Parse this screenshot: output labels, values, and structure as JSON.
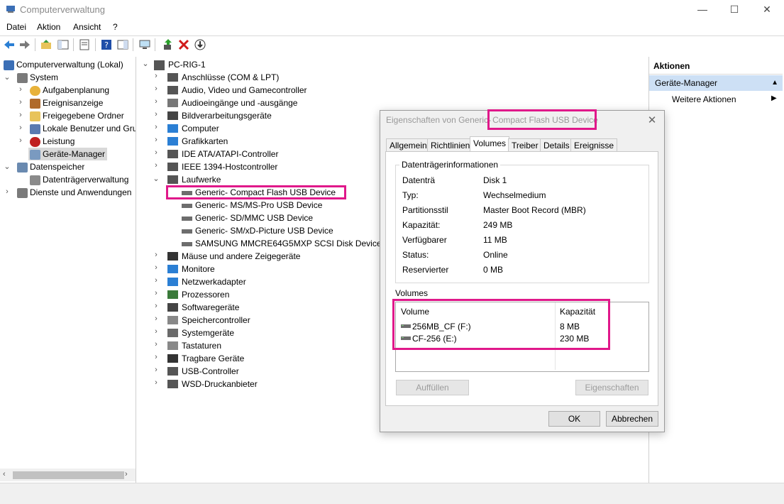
{
  "window": {
    "title": "Computerverwaltung",
    "minimize": "—",
    "maximize": "☐",
    "close": "✕"
  },
  "menu": [
    "Datei",
    "Aktion",
    "Ansicht",
    "?"
  ],
  "left_tree": [
    {
      "label": "Computerverwaltung (Lokal)",
      "icon": "computer-management-icon"
    },
    {
      "label": "System",
      "icon": "system-tools-icon"
    },
    {
      "label": "Aufgabenplanung",
      "icon": "clock-icon"
    },
    {
      "label": "Ereignisanzeige",
      "icon": "event-viewer-icon"
    },
    {
      "label": "Freigegebene Ordner",
      "icon": "shared-folder-icon"
    },
    {
      "label": "Lokale Benutzer und Gru",
      "icon": "users-icon"
    },
    {
      "label": "Leistung",
      "icon": "performance-icon"
    },
    {
      "label": "Geräte-Manager",
      "icon": "device-manager-icon"
    },
    {
      "label": "Datenspeicher",
      "icon": "storage-icon"
    },
    {
      "label": "Datenträgerverwaltung",
      "icon": "disk-management-icon"
    },
    {
      "label": "Dienste und Anwendungen",
      "icon": "services-icon"
    }
  ],
  "device_tree": {
    "root": "PC-RIG-1",
    "categories": [
      "Anschlüsse (COM & LPT)",
      "Audio, Video und Gamecontroller",
      "Audioeingänge und -ausgänge",
      "Bildverarbeitungsgeräte",
      "Computer",
      "Grafikkarten",
      "IDE ATA/ATAPI-Controller",
      "IEEE 1394-Hostcontroller",
      "Laufwerke"
    ],
    "drives": [
      "Generic- Compact Flash USB Device",
      "Generic- MS/MS-Pro USB Device",
      "Generic- SD/MMC USB Device",
      "Generic- SM/xD-Picture USB Device",
      "SAMSUNG MMCRE64G5MXP SCSI Disk Device"
    ],
    "categories_after": [
      "Mäuse und andere Zeigegeräte",
      "Monitore",
      "Netzwerkadapter",
      "Prozessoren",
      "Softwaregeräte",
      "Speichercontroller",
      "Systemgeräte",
      "Tastaturen",
      "Tragbare Geräte",
      "USB-Controller",
      "WSD-Druckanbieter"
    ]
  },
  "actions": {
    "header": "Aktionen",
    "section": "Geräte-Manager",
    "more": "Weitere Aktionen"
  },
  "dialog": {
    "title_prefix": "Eigenschaften von Generic-",
    "title_highlight": "Compact Flash USB Device",
    "tabs": [
      "Allgemein",
      "Richtlinien",
      "Volumes",
      "Treiber",
      "Details",
      "Ereignisse"
    ],
    "group_title": "Datenträgerinformationen",
    "info": [
      {
        "k": "Datenträ",
        "v": "Disk 1"
      },
      {
        "k": "Typ:",
        "v": "Wechselmedium"
      },
      {
        "k": "Partitionsstil",
        "v": "Master Boot Record (MBR)"
      },
      {
        "k": "Kapazität:",
        "v": "249 MB"
      },
      {
        "k": "Verfügbarer",
        "v": "11 MB"
      },
      {
        "k": "Status:",
        "v": "Online"
      },
      {
        "k": "Reservierter",
        "v": "0 MB"
      }
    ],
    "volumes_label": "Volumes",
    "vol_headers": [
      "Volume",
      "Kapazität"
    ],
    "volumes": [
      {
        "name": "256MB_CF (F:)",
        "cap": "8 MB"
      },
      {
        "name": "CF-256 (E:)",
        "cap": "230 MB"
      }
    ],
    "fill_button": "Auffüllen",
    "props_button": "Eigenschaften",
    "ok": "OK",
    "cancel": "Abbrechen"
  }
}
